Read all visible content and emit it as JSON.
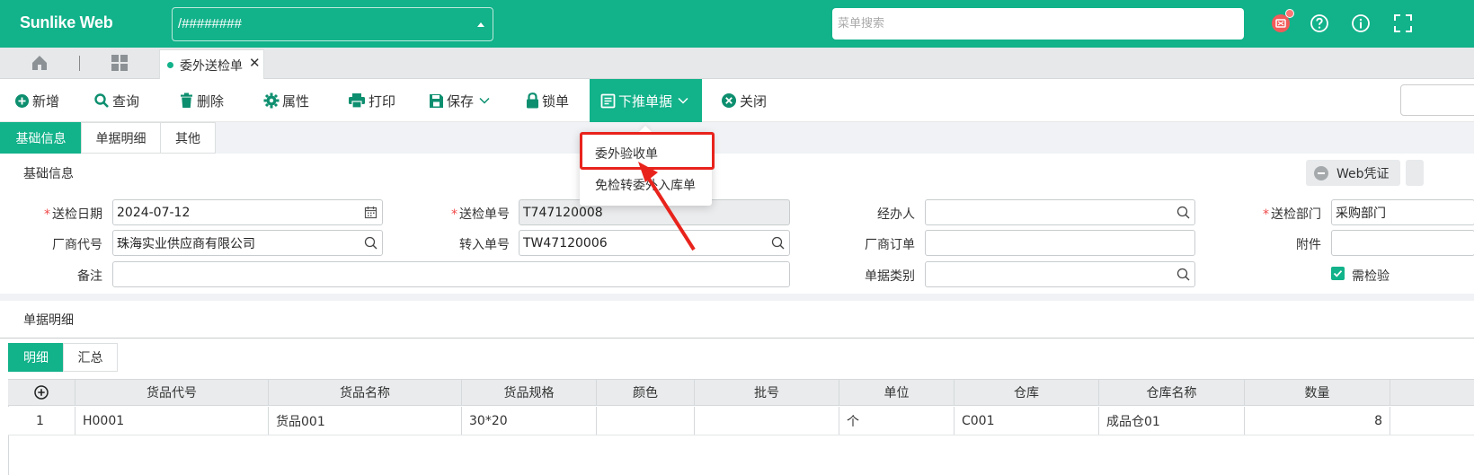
{
  "header": {
    "brand": "Sunlike Web",
    "org_value": "/########",
    "menu_search_placeholder": "菜单搜索"
  },
  "tabs": {
    "open_tab_label": "委外送检单"
  },
  "toolbar": {
    "new": "新增",
    "query": "查询",
    "delete": "删除",
    "properties": "属性",
    "print": "打印",
    "save": "保存",
    "lock": "锁单",
    "push_down": "下推单据",
    "close": "关闭"
  },
  "push_menu": {
    "items": [
      "委外验收单",
      "免检转委外入库单"
    ]
  },
  "section_tabs": [
    "基础信息",
    "单据明细",
    "其他"
  ],
  "basic_info": {
    "title": "基础信息",
    "voucher_button": "Web凭证",
    "fields": {
      "inspect_date": {
        "label": "送检日期",
        "value": "2024-07-12"
      },
      "inspect_no": {
        "label": "送检单号",
        "value": "T747120008"
      },
      "handler": {
        "label": "经办人",
        "value": ""
      },
      "inspect_dept": {
        "label": "送检部门",
        "value": "采购部门"
      },
      "vendor_code": {
        "label": "厂商代号",
        "value": "珠海实业供应商有限公司"
      },
      "transfer_no": {
        "label": "转入单号",
        "value": "TW47120006"
      },
      "vendor_order": {
        "label": "厂商订单",
        "value": ""
      },
      "attachment": {
        "label": "附件",
        "value": ""
      },
      "remark": {
        "label": "备注",
        "value": ""
      },
      "doc_category": {
        "label": "单据类别",
        "value": ""
      },
      "need_inspect": {
        "label": "需检验",
        "checked": true
      }
    }
  },
  "detail": {
    "title": "单据明细",
    "tabs": [
      "明细",
      "汇总"
    ],
    "columns": [
      "货品代号",
      "货品名称",
      "货品规格",
      "颜色",
      "批号",
      "单位",
      "仓库",
      "仓库名称",
      "数量"
    ],
    "rows": [
      {
        "no": "1",
        "item_code": "H0001",
        "item_name": "货品001",
        "spec": "30*20",
        "color": "",
        "batch": "",
        "unit": "个",
        "warehouse": "C001",
        "warehouse_name": "成品仓01",
        "qty": "8"
      }
    ]
  },
  "colors": {
    "primary": "#12b28a",
    "required": "#f04848",
    "highlight": "#e8231c"
  }
}
